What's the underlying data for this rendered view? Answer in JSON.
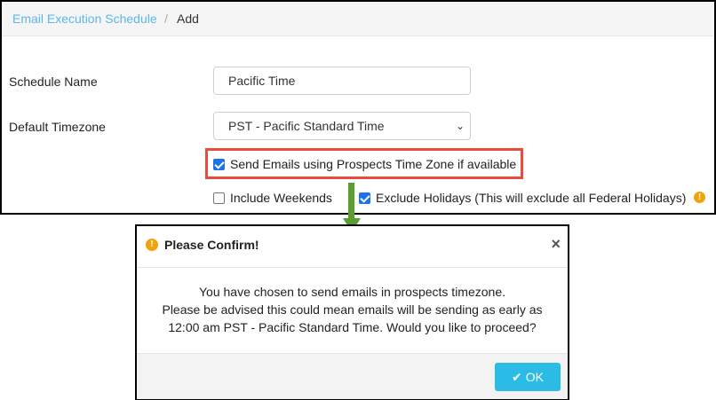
{
  "breadcrumb": {
    "parent": "Email Execution Schedule",
    "separator": "/",
    "current": "Add"
  },
  "form": {
    "schedule_name_label": "Schedule Name",
    "schedule_name_value": "Pacific Time",
    "timezone_label": "Default Timezone",
    "timezone_value": "PST - Pacific Standard Time",
    "prospects_tz_label": "Send Emails using Prospects Time Zone if available",
    "prospects_tz_checked": true,
    "weekends_label": "Include Weekends",
    "weekends_checked": false,
    "holidays_label": "Exclude Holidays (This will exclude all Federal Holidays)",
    "holidays_checked": true,
    "icons": {
      "select_caret": "chevron-down-icon",
      "holidays_info": "info-icon"
    }
  },
  "modal": {
    "title": "Please Confirm!",
    "close": "×",
    "message_lines": [
      "You have chosen to send emails in prospects timezone.",
      "Please be advised this could mean emails will be sending as early as",
      "12:00 am PST - Pacific Standard Time. Would you like to proceed?"
    ],
    "ok_label": "OK",
    "icons": {
      "header": "warning-icon",
      "ok": "check-icon"
    }
  },
  "colors": {
    "link": "#5bb8e8",
    "highlight_border": "#e84c3d",
    "arrow": "#5a9e2f",
    "ok_button": "#2bbbe7",
    "checkbox_checked": "#1a73e8",
    "warning": "#f0a30a"
  }
}
